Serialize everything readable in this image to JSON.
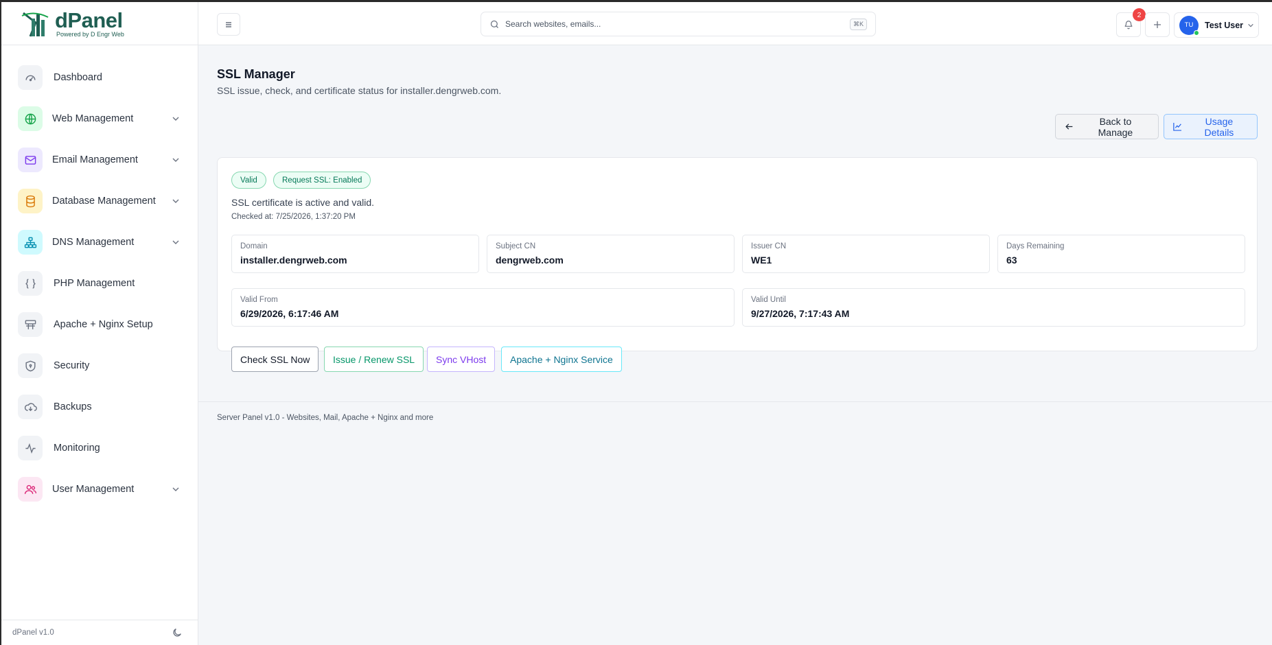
{
  "brand": {
    "name": "dPanel",
    "tagline": "Powered by D Engr Web",
    "version": "dPanel v1.0"
  },
  "sidebar": {
    "items": [
      {
        "label": "Dashboard",
        "icon": "gauge-icon",
        "expandable": false
      },
      {
        "label": "Web Management",
        "icon": "globe-icon",
        "expandable": true,
        "color": "#16a34a"
      },
      {
        "label": "Email Management",
        "icon": "mail-icon",
        "expandable": true,
        "color": "#7c3aed"
      },
      {
        "label": "Database Management",
        "icon": "database-icon",
        "expandable": true,
        "color": "#d97706"
      },
      {
        "label": "DNS Management",
        "icon": "network-icon",
        "expandable": true,
        "color": "#0891b2"
      },
      {
        "label": "PHP Management",
        "icon": "braces-icon",
        "expandable": false
      },
      {
        "label": "Apache + Nginx Setup",
        "icon": "server-icon",
        "expandable": false
      },
      {
        "label": "Security",
        "icon": "shield-icon",
        "expandable": false
      },
      {
        "label": "Backups",
        "icon": "cloud-download-icon",
        "expandable": false
      },
      {
        "label": "Monitoring",
        "icon": "activity-icon",
        "expandable": false
      },
      {
        "label": "User Management",
        "icon": "users-icon",
        "expandable": true,
        "color": "#db2777"
      }
    ]
  },
  "header": {
    "search_placeholder": "Search websites, emails...",
    "shortcut": "⌘K",
    "notification_count": "2",
    "user_initials": "TU",
    "user_name": "Test User"
  },
  "page": {
    "title": "SSL Manager",
    "subtitle": "SSL issue, check, and certificate status for installer.dengrweb.com.",
    "back_label": "Back to Manage",
    "usage_label": "Usage Details"
  },
  "ssl": {
    "status_badge": "Valid",
    "request_badge": "Request SSL: Enabled",
    "message": "SSL certificate is active and valid.",
    "checked_at": "Checked at: 7/25/2026, 1:37:20 PM",
    "fields": {
      "domain": {
        "label": "Domain",
        "value": "installer.dengrweb.com"
      },
      "subject_cn": {
        "label": "Subject CN",
        "value": "dengrweb.com"
      },
      "issuer_cn": {
        "label": "Issuer CN",
        "value": "WE1"
      },
      "days_remaining": {
        "label": "Days Remaining",
        "value": "63"
      },
      "valid_from": {
        "label": "Valid From",
        "value": "6/29/2026, 6:17:46 AM"
      },
      "valid_until": {
        "label": "Valid Until",
        "value": "9/27/2026, 7:17:43 AM"
      }
    },
    "actions": {
      "check": "Check SSL Now",
      "issue": "Issue / Renew SSL",
      "sync": "Sync VHost",
      "apache": "Apache + Nginx Service"
    }
  },
  "footer": {
    "text": "Server Panel v1.0 - Websites, Mail, Apache + Nginx and more"
  },
  "colors": {
    "accent": "#2563eb",
    "success": "#059669",
    "brand": "#1f5e52"
  }
}
